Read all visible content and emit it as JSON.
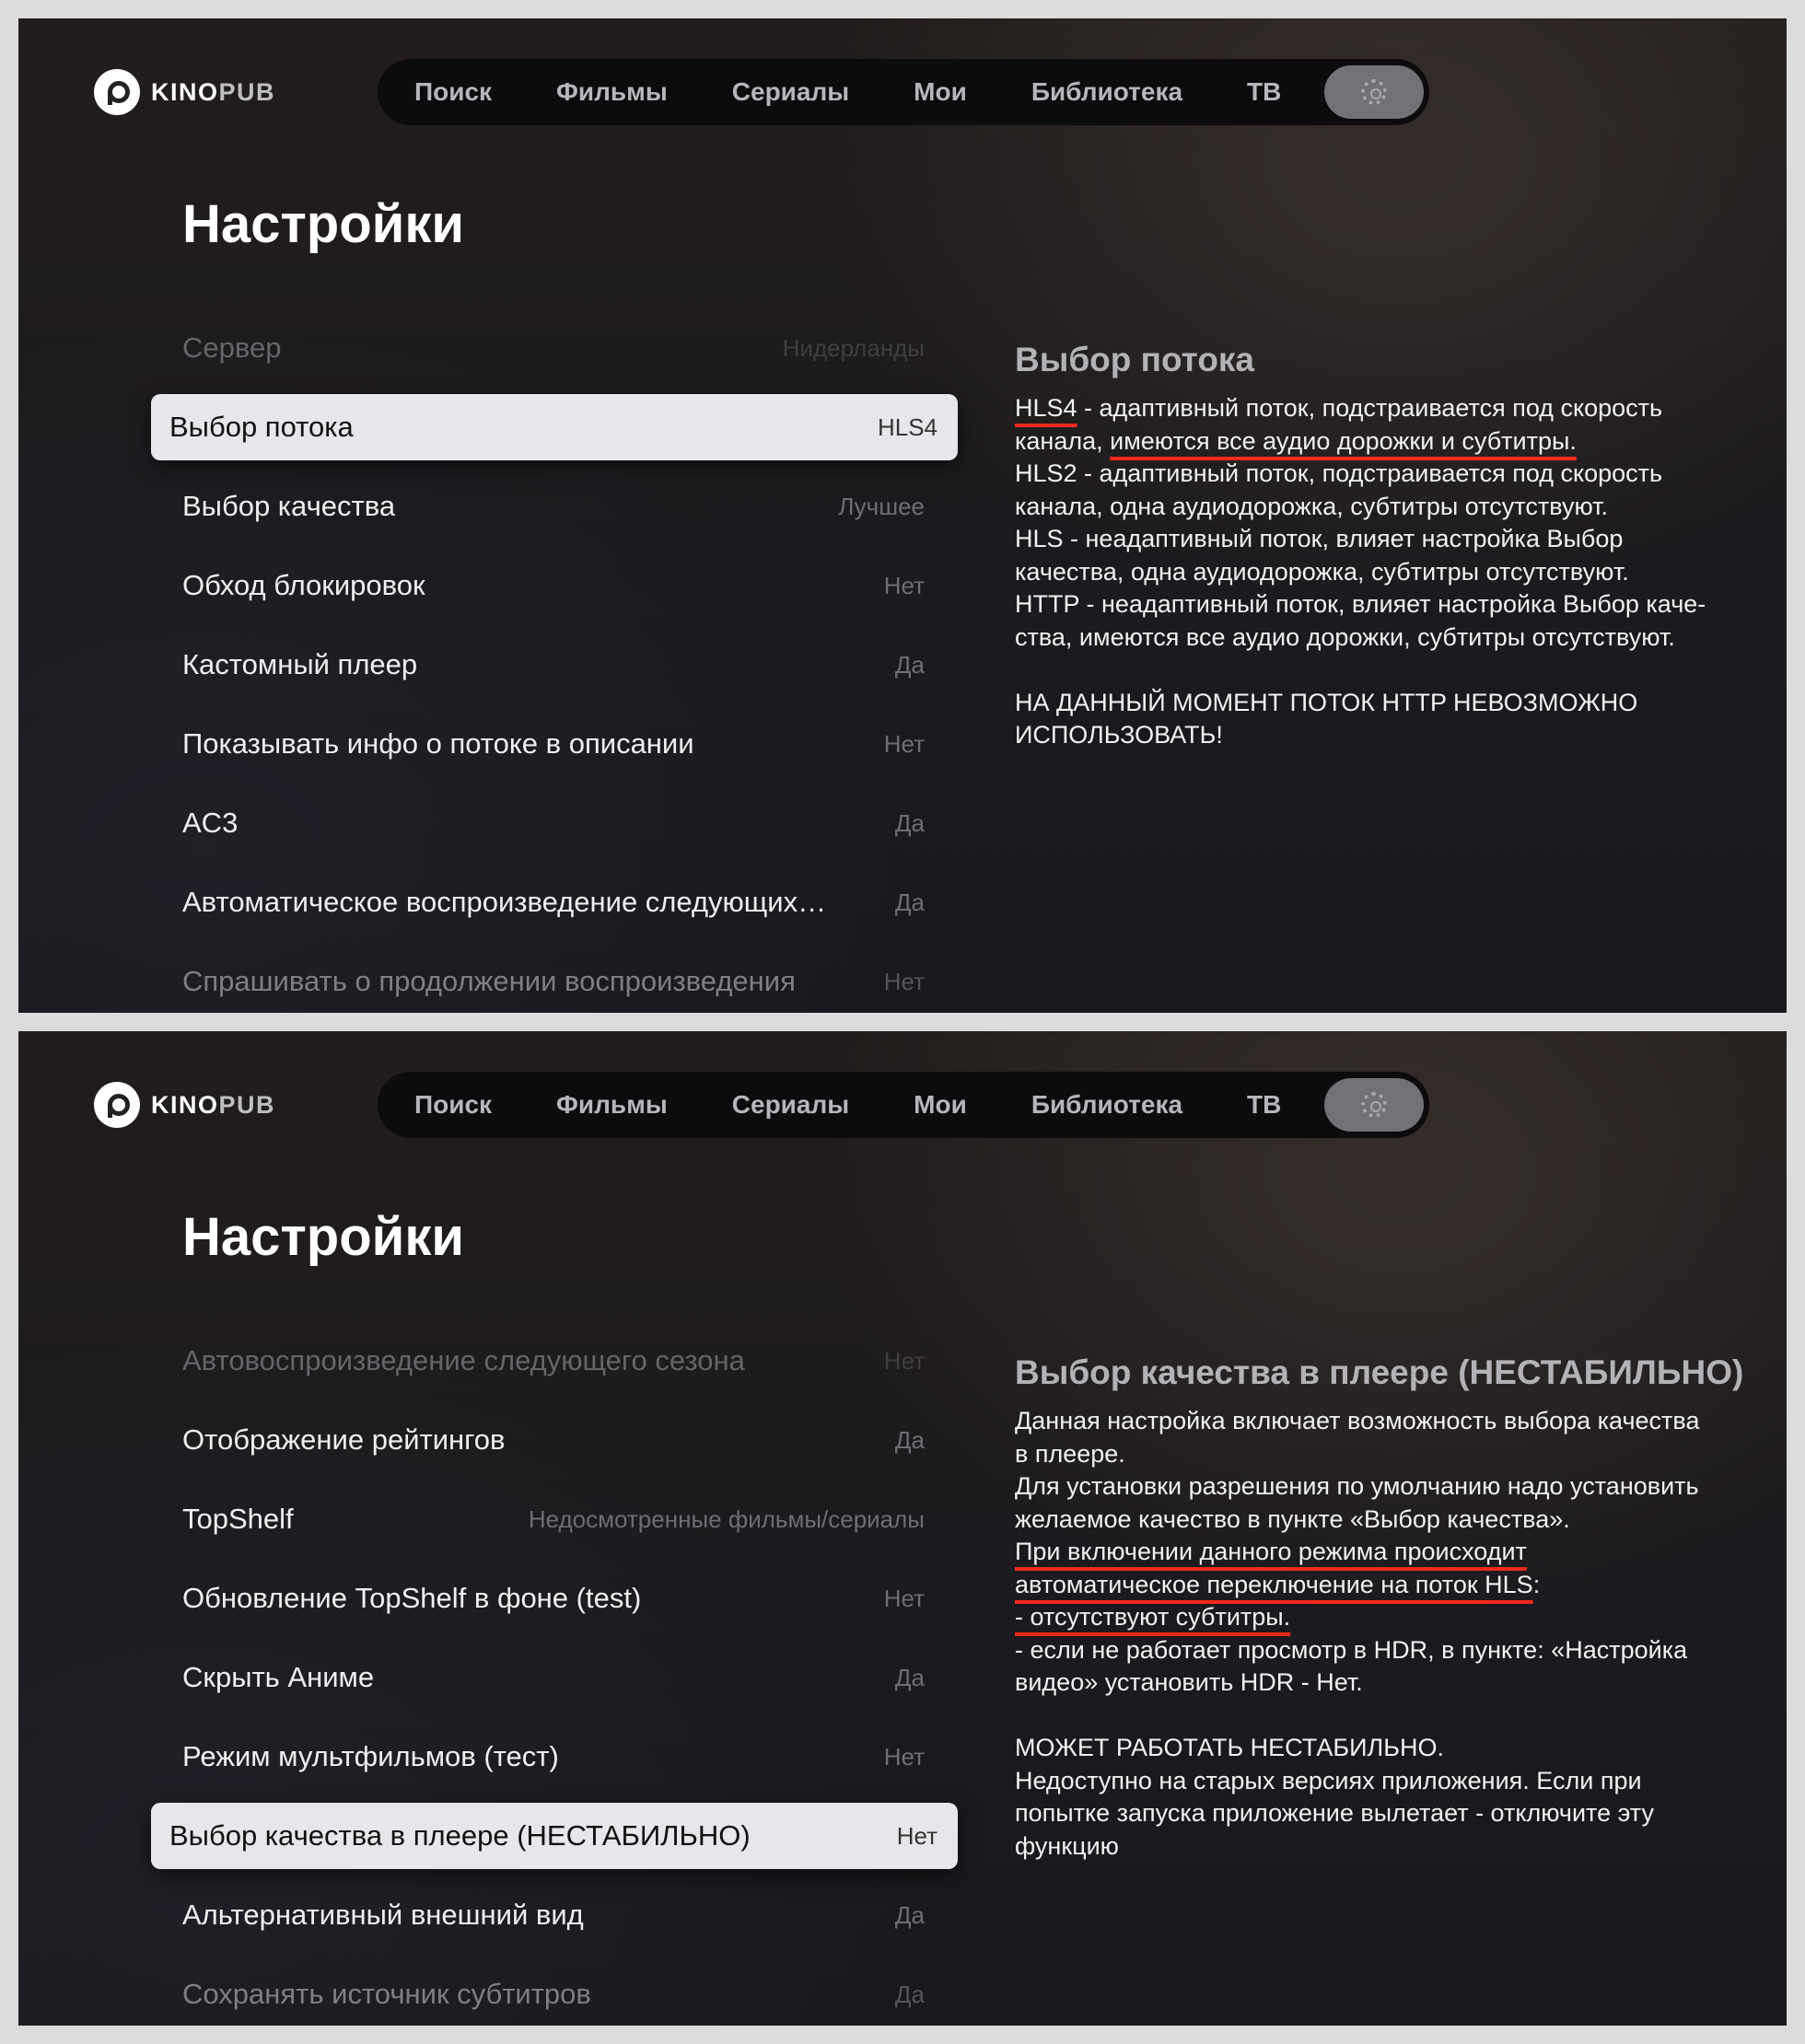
{
  "colors": {
    "background": "#1e1b1e",
    "selected_row": "#e7e6ea",
    "annotation_underline": "#ef2b1d",
    "nav_bar": "#0c0b0d"
  },
  "app": {
    "logo_kino": "KINO",
    "logo_pub": "PUB",
    "logo_icon": "kinopub-logo-icon"
  },
  "nav": {
    "items": [
      "Поиск",
      "Фильмы",
      "Сериалы",
      "Мои",
      "Библиотека",
      "ТВ"
    ],
    "settings_icon": "gear-icon"
  },
  "screens": [
    {
      "title": "Настройки",
      "rows": [
        {
          "label": "Сервер",
          "value": "Нидерланды",
          "state": "faded"
        },
        {
          "label": "Выбор потока",
          "value": "HLS4",
          "state": "selected"
        },
        {
          "label": "Выбор качества",
          "value": "Лучшее",
          "state": "normal"
        },
        {
          "label": "Обход блокировок",
          "value": "Нет",
          "state": "normal"
        },
        {
          "label": "Кастомный плеер",
          "value": "Да",
          "state": "normal"
        },
        {
          "label": "Показывать инфо о потоке в описании",
          "value": "Нет",
          "state": "normal"
        },
        {
          "label": "AC3",
          "value": "Да",
          "state": "normal"
        },
        {
          "label": "Автоматическое воспроизведение следующих…",
          "value": "Да",
          "state": "normal"
        },
        {
          "label": "Спрашивать о продолжении воспроизведения",
          "value": "Нет",
          "state": "half"
        }
      ],
      "description": {
        "title": "Выбор потока",
        "lines": [
          [
            {
              "text": "HLS4",
              "u": true
            },
            {
              "text": " - адаптивный поток, подстраивается под скорость",
              "u": false
            }
          ],
          [
            {
              "text": "канала, ",
              "u": false
            },
            {
              "text": "имеются все аудио дорожки и субтитры.",
              "u": true
            }
          ],
          [
            {
              "text": "HLS2 - адаптивный поток, подстраивается под скорость",
              "u": false
            }
          ],
          [
            {
              "text": "канала, одна аудиодорожка, субтитры отсутствуют.",
              "u": false
            }
          ],
          [
            {
              "text": "HLS - неадаптивный поток, влияет настройка Выбор",
              "u": false
            }
          ],
          [
            {
              "text": "качества, одна аудиодорожка, субтитры отсутствуют.",
              "u": false
            }
          ],
          [
            {
              "text": "HTTP - неадаптивный поток, влияет настройка Выбор каче-",
              "u": false
            }
          ],
          [
            {
              "text": "ства, имеются все аудио дорожки, субтитры отсутствуют.",
              "u": false
            }
          ],
          [],
          [
            {
              "text": "НА ДАННЫЙ МОМЕНТ ПОТОК HTTP НЕВОЗМОЖНО",
              "u": false
            }
          ],
          [
            {
              "text": "ИСПОЛЬЗОВАТЬ!",
              "u": false
            }
          ]
        ]
      }
    },
    {
      "title": "Настройки",
      "rows": [
        {
          "label": "Автовоспроизведение следующего сезона",
          "value": "Нет",
          "state": "faded"
        },
        {
          "label": "Отображение рейтингов",
          "value": "Да",
          "state": "normal"
        },
        {
          "label": "TopShelf",
          "value": "Недосмотренные фильмы/сериалы",
          "state": "normal"
        },
        {
          "label": "Обновление TopShelf в фоне (test)",
          "value": "Нет",
          "state": "normal"
        },
        {
          "label": "Скрыть Аниме",
          "value": "Да",
          "state": "normal"
        },
        {
          "label": "Режим мультфильмов (тест)",
          "value": "Нет",
          "state": "normal"
        },
        {
          "label": "Выбор качества в плеере (НЕСТАБИЛЬНО)",
          "value": "Нет",
          "state": "selected"
        },
        {
          "label": "Альтернативный внешний вид",
          "value": "Да",
          "state": "normal"
        },
        {
          "label": "Сохранять источник субтитров",
          "value": "Да",
          "state": "half"
        }
      ],
      "description": {
        "title": "Выбор качества в плеере (НЕСТАБИЛЬНО)",
        "lines": [
          [
            {
              "text": "Данная настройка включает возможность выбора качества",
              "u": false
            }
          ],
          [
            {
              "text": "в плеере.",
              "u": false
            }
          ],
          [
            {
              "text": "Для установки разрешения по умолчанию надо установить",
              "u": false
            }
          ],
          [
            {
              "text": "желаемое качество в пункте «Выбор качества».",
              "u": false
            }
          ],
          [
            {
              "text": "При включении данного режима происходит",
              "u": true
            }
          ],
          [
            {
              "text": "автоматическое переключение на поток HLS",
              "u": true
            },
            {
              "text": ":",
              "u": false
            }
          ],
          [
            {
              "text": "- отсутствуют субтитры.",
              "u": true
            }
          ],
          [
            {
              "text": "- если не работает просмотр в HDR, в пункте: «Настройка",
              "u": false
            }
          ],
          [
            {
              "text": "видео» установить HDR - Нет.",
              "u": false
            }
          ],
          [],
          [
            {
              "text": "МОЖЕТ РАБОТАТЬ НЕСТАБИЛЬНО.",
              "u": false
            }
          ],
          [
            {
              "text": "Недоступно на старых версиях приложения. Если при",
              "u": false
            }
          ],
          [
            {
              "text": "попытке запуска приложение вылетает - отключите эту",
              "u": false
            }
          ],
          [
            {
              "text": "функцию",
              "u": false
            }
          ]
        ]
      }
    }
  ]
}
